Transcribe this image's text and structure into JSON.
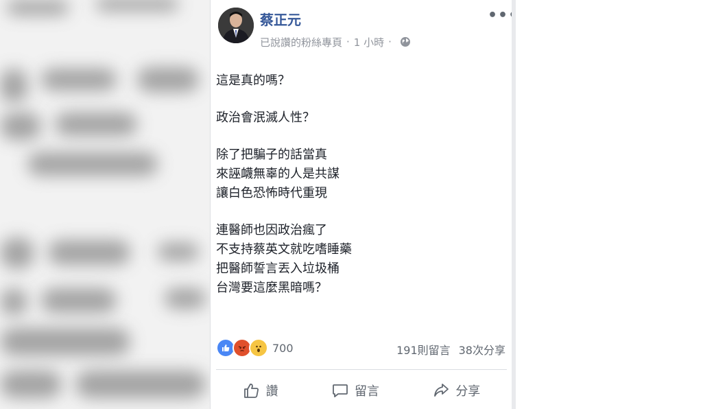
{
  "post": {
    "author": "蔡正元",
    "meta": {
      "relation": "已說讚的粉絲專頁",
      "separator": "·",
      "time": "1 小時",
      "privacy_icon": "globe-icon"
    },
    "more_icon": "more-dots-icon",
    "more_label": "•••",
    "paragraphs": [
      [
        "這是真的嗎？"
      ],
      [
        "政治會泯滅人性？"
      ],
      [
        "除了把騙子的話當真",
        "來誣衊無辜的人是共謀",
        "讓白色恐怖時代重現"
      ],
      [
        "連醫師也因政治瘋了",
        "不支持蔡英文就吃嗜睡藥",
        "把醫師誓言丟入垃圾桶",
        "台灣要這麼黑暗嗎？"
      ]
    ],
    "reactions": {
      "icons": [
        "like-reaction-icon",
        "angry-reaction-icon",
        "wow-reaction-icon"
      ],
      "count": "700"
    },
    "stats": {
      "comments": "191則留言",
      "shares": "38次分享"
    },
    "actions": {
      "like": "讚",
      "comment": "留言",
      "share": "分享"
    }
  },
  "colors": {
    "author_link": "#365899",
    "meta_text": "#90949c",
    "body_text": "#1d2129"
  }
}
